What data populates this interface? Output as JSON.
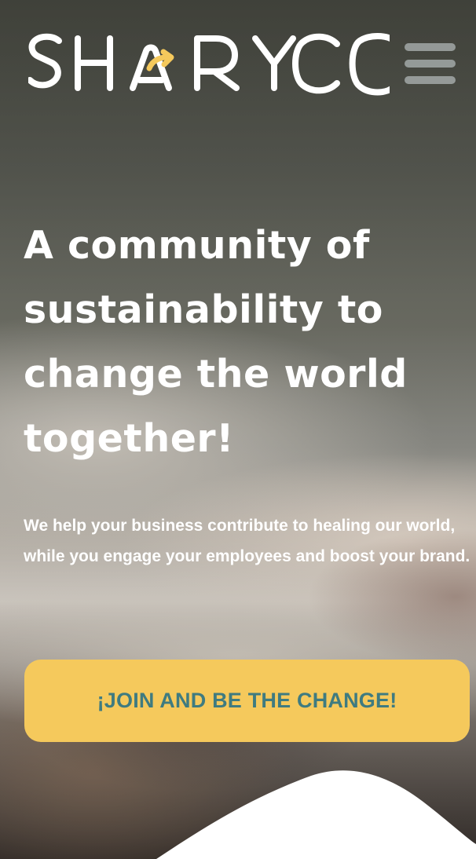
{
  "brand": {
    "name": "SHARYCO",
    "colors": {
      "logo_white": "#ffffff",
      "logo_accent": "#f5c95c",
      "menu": "#afb6b6"
    }
  },
  "header": {
    "menu_icon": "hamburger-menu-icon"
  },
  "hero": {
    "headline": "A community of sustainability to change the world together!",
    "subtext": "We help your business contribute to healing our world, while you engage your employees and boost your brand.",
    "cta_label": "¡JOIN AND BE THE CHANGE!",
    "colors": {
      "headline": "#ffffff",
      "subtext": "#ffffff",
      "cta_background": "#f5c95c",
      "cta_text": "#3f7b80"
    }
  }
}
